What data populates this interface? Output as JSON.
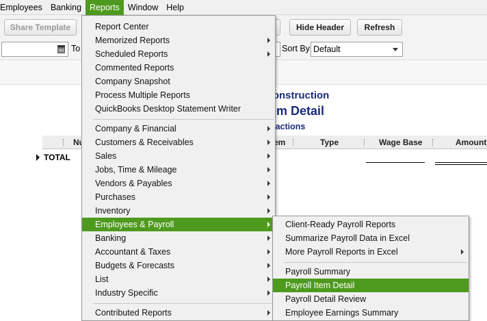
{
  "menubar": [
    "Employees",
    "Banking",
    "Reports",
    "Window",
    "Help"
  ],
  "toolbar": {
    "share_template": "Share Template",
    "hide_header": "Hide Header",
    "refresh": "Refresh"
  },
  "filter": {
    "to_label": "To",
    "sort_by_label": "Sort By",
    "sort_by_value": "Default"
  },
  "report": {
    "company": "Construction",
    "title": "tem Detail",
    "subtitle": "nsactions",
    "columns": [
      "Nu",
      "em",
      "Type",
      "Wage Base",
      "Amount"
    ],
    "total_label": "TOTAL"
  },
  "reports_menu": {
    "group1": [
      "Report Center",
      "Memorized Reports",
      "Scheduled Reports",
      "Commented Reports",
      "Company Snapshot",
      "Process Multiple Reports",
      "QuickBooks Desktop Statement Writer"
    ],
    "group2": [
      "Company & Financial",
      "Customers & Receivables",
      "Sales",
      "Jobs, Time & Mileage",
      "Vendors & Payables",
      "Purchases",
      "Inventory",
      "Employees & Payroll",
      "Banking",
      "Accountant & Taxes",
      "Budgets & Forecasts",
      "List",
      "Industry Specific"
    ],
    "group3": [
      "Contributed Reports"
    ]
  },
  "payroll_submenu": {
    "group1": [
      "Client-Ready Payroll Reports",
      "Summarize Payroll Data in Excel",
      "More Payroll Reports in Excel"
    ],
    "group2": [
      "Payroll Summary",
      "Payroll Item Detail",
      "Payroll Detail Review",
      "Employee Earnings Summary"
    ]
  },
  "colors": {
    "highlight": "#4e9a1e",
    "report_heading": "#1c2a7a"
  }
}
